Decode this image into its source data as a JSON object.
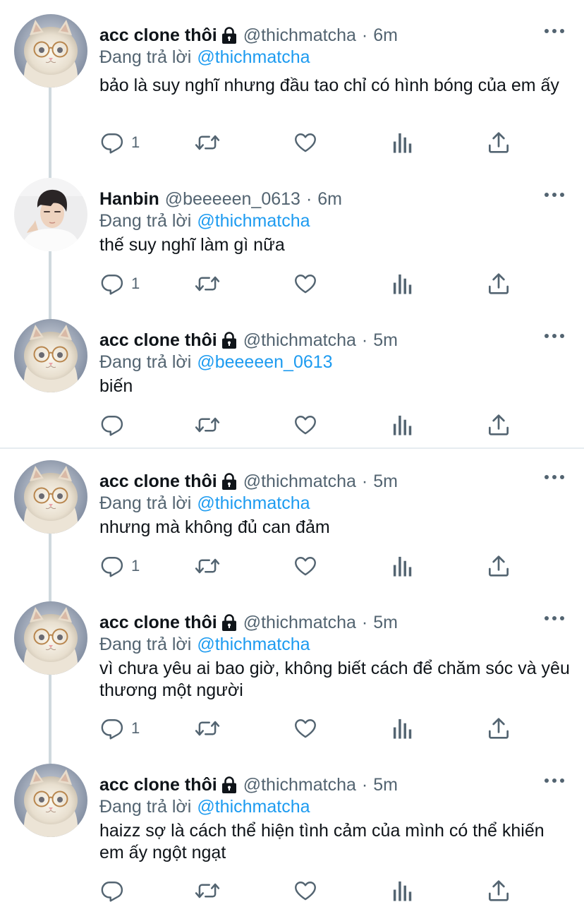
{
  "tweets": [
    {
      "name": "acc clone thôi",
      "handle": "@thichmatcha",
      "separator": "·",
      "time": "6m",
      "protected": true,
      "replying_label": "Đang trả lời",
      "replying_to": "@thichmatcha",
      "text": "bảo là suy nghĩ nhưng đầu tao chỉ có hình bóng của em ấy",
      "reply_count": "1",
      "avatar": "cat"
    },
    {
      "name": "Hanbin",
      "handle": "@beeeeen_0613",
      "separator": "·",
      "time": "6m",
      "protected": false,
      "replying_label": "Đang trả lời",
      "replying_to": "@thichmatcha",
      "text": "thế suy nghĩ làm gì nữa",
      "reply_count": "1",
      "avatar": "person"
    },
    {
      "name": "acc clone thôi",
      "handle": "@thichmatcha",
      "separator": "·",
      "time": "5m",
      "protected": true,
      "replying_label": "Đang trả lời",
      "replying_to": "@beeeeen_0613",
      "text": "biến",
      "reply_count": "",
      "avatar": "cat"
    },
    {
      "name": "acc clone thôi",
      "handle": "@thichmatcha",
      "separator": "·",
      "time": "5m",
      "protected": true,
      "replying_label": "Đang trả lời",
      "replying_to": "@thichmatcha",
      "text": "nhưng mà không đủ can đảm",
      "reply_count": "1",
      "avatar": "cat"
    },
    {
      "name": "acc clone thôi",
      "handle": "@thichmatcha",
      "separator": "·",
      "time": "5m",
      "protected": true,
      "replying_label": "Đang trả lời",
      "replying_to": "@thichmatcha",
      "text": "vì chưa yêu ai bao giờ, không biết cách để chăm sóc và yêu thương một người",
      "reply_count": "1",
      "avatar": "cat"
    },
    {
      "name": "acc clone thôi",
      "handle": "@thichmatcha",
      "separator": "·",
      "time": "5m",
      "protected": true,
      "replying_label": "Đang trả lời",
      "replying_to": "@thichmatcha",
      "text": "haizz sợ là cách thể hiện tình cảm của mình có thể khiến em ấy ngột ngạt",
      "reply_count": "",
      "avatar": "cat"
    }
  ],
  "icons": {
    "reply": "reply-icon",
    "retweet": "retweet-icon",
    "like": "heart-icon",
    "views": "analytics-icon",
    "share": "share-icon",
    "more": "more-dots-icon",
    "lock": "lock-icon"
  },
  "colors": {
    "text": "#0f1419",
    "secondary": "#536471",
    "link": "#1d9bf0",
    "thread_line": "#cfd9de"
  }
}
